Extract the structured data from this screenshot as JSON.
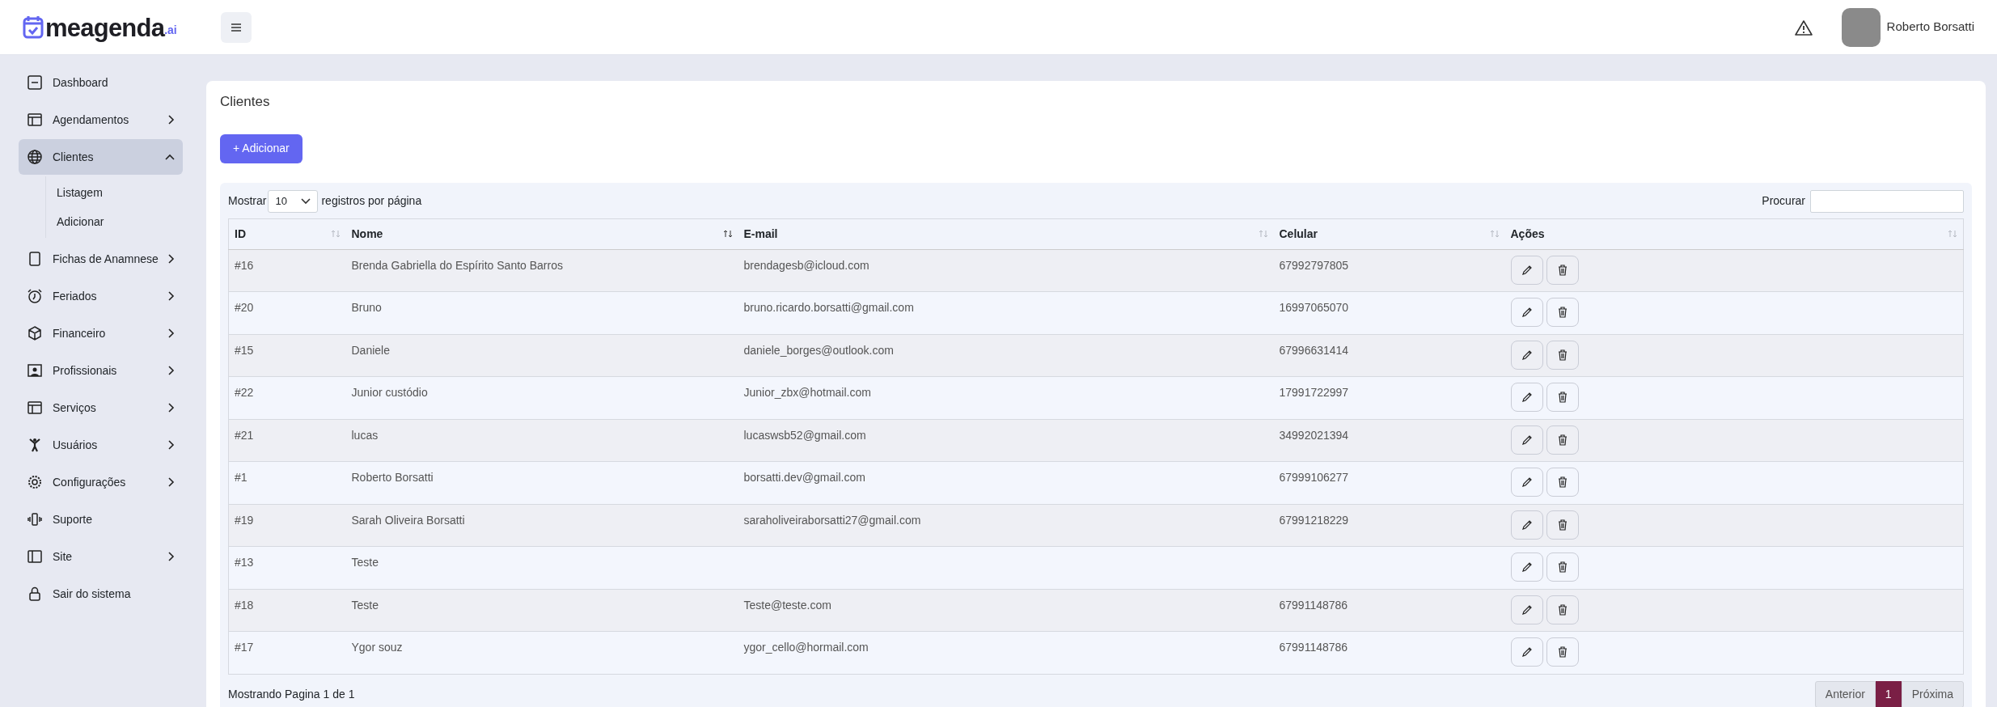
{
  "header": {
    "logo": "meagenda",
    "logo_suffix": ".ai",
    "user_name": "Roberto Borsatti"
  },
  "sidebar": {
    "items": [
      {
        "label": "Dashboard",
        "kind": "link",
        "selected": false
      },
      {
        "label": "Agendamentos",
        "kind": "menu",
        "selected": false,
        "expanded": false
      },
      {
        "label": "Clientes",
        "kind": "menu",
        "selected": true,
        "expanded": true,
        "children": [
          {
            "label": "Listagem"
          },
          {
            "label": "Adicionar"
          }
        ]
      },
      {
        "label": "Fichas de Anamnese",
        "kind": "menu",
        "selected": false,
        "expanded": false
      },
      {
        "label": "Feriados",
        "kind": "menu",
        "selected": false,
        "expanded": false
      },
      {
        "label": "Financeiro",
        "kind": "menu",
        "selected": false,
        "expanded": false
      },
      {
        "label": "Profissionais",
        "kind": "menu",
        "selected": false,
        "expanded": false
      },
      {
        "label": "Serviços",
        "kind": "menu",
        "selected": false,
        "expanded": false
      },
      {
        "label": "Usuários",
        "kind": "menu",
        "selected": false,
        "expanded": false
      },
      {
        "label": "Configurações",
        "kind": "menu",
        "selected": false,
        "expanded": false
      },
      {
        "label": "Suporte",
        "kind": "link",
        "selected": false
      },
      {
        "label": "Site",
        "kind": "menu",
        "selected": false,
        "expanded": false
      },
      {
        "label": "Sair do sistema",
        "kind": "link",
        "selected": false
      }
    ]
  },
  "page": {
    "title": "Clientes",
    "add_button": "+ Adicionar"
  },
  "table": {
    "show_label": "Mostrar",
    "page_size": "10",
    "per_page_label": "registros por página",
    "search_label": "Procurar",
    "columns": [
      {
        "label": "ID",
        "sorted": false
      },
      {
        "label": "Nome",
        "sorted": true
      },
      {
        "label": "E-mail",
        "sorted": false
      },
      {
        "label": "Celular",
        "sorted": false
      },
      {
        "label": "Ações",
        "sorted": false
      }
    ],
    "rows": [
      [
        "#16",
        "Brenda Gabriella do Espírito Santo Barros",
        "brendagesb@icloud.com",
        "67992797805"
      ],
      [
        "#20",
        "Bruno",
        "bruno.ricardo.borsatti@gmail.com",
        "16997065070"
      ],
      [
        "#15",
        "Daniele",
        "daniele_borges@outlook.com",
        "67996631414"
      ],
      [
        "#22",
        "Junior custódio",
        "Junior_zbx@hotmail.com",
        "17991722997"
      ],
      [
        "#21",
        "lucas",
        "lucaswsb52@gmail.com",
        "34992021394"
      ],
      [
        "#1",
        "Roberto Borsatti",
        "borsatti.dev@gmail.com",
        "67999106277"
      ],
      [
        "#19",
        "Sarah Oliveira Borsatti",
        "saraholiveiraborsatti27@gmail.com",
        "67991218229"
      ],
      [
        "#13",
        "Teste",
        "",
        ""
      ],
      [
        "#18",
        "Teste",
        "Teste@teste.com",
        "67991148786"
      ],
      [
        "#17",
        "Ygor souz",
        "ygor_cello@hormail.com",
        "67991148786"
      ]
    ],
    "info": "Mostrando Pagina 1 de 1",
    "previous": "Anterior",
    "next": "Próxima",
    "pages": [
      {
        "label": "1",
        "selected": true
      }
    ]
  }
}
